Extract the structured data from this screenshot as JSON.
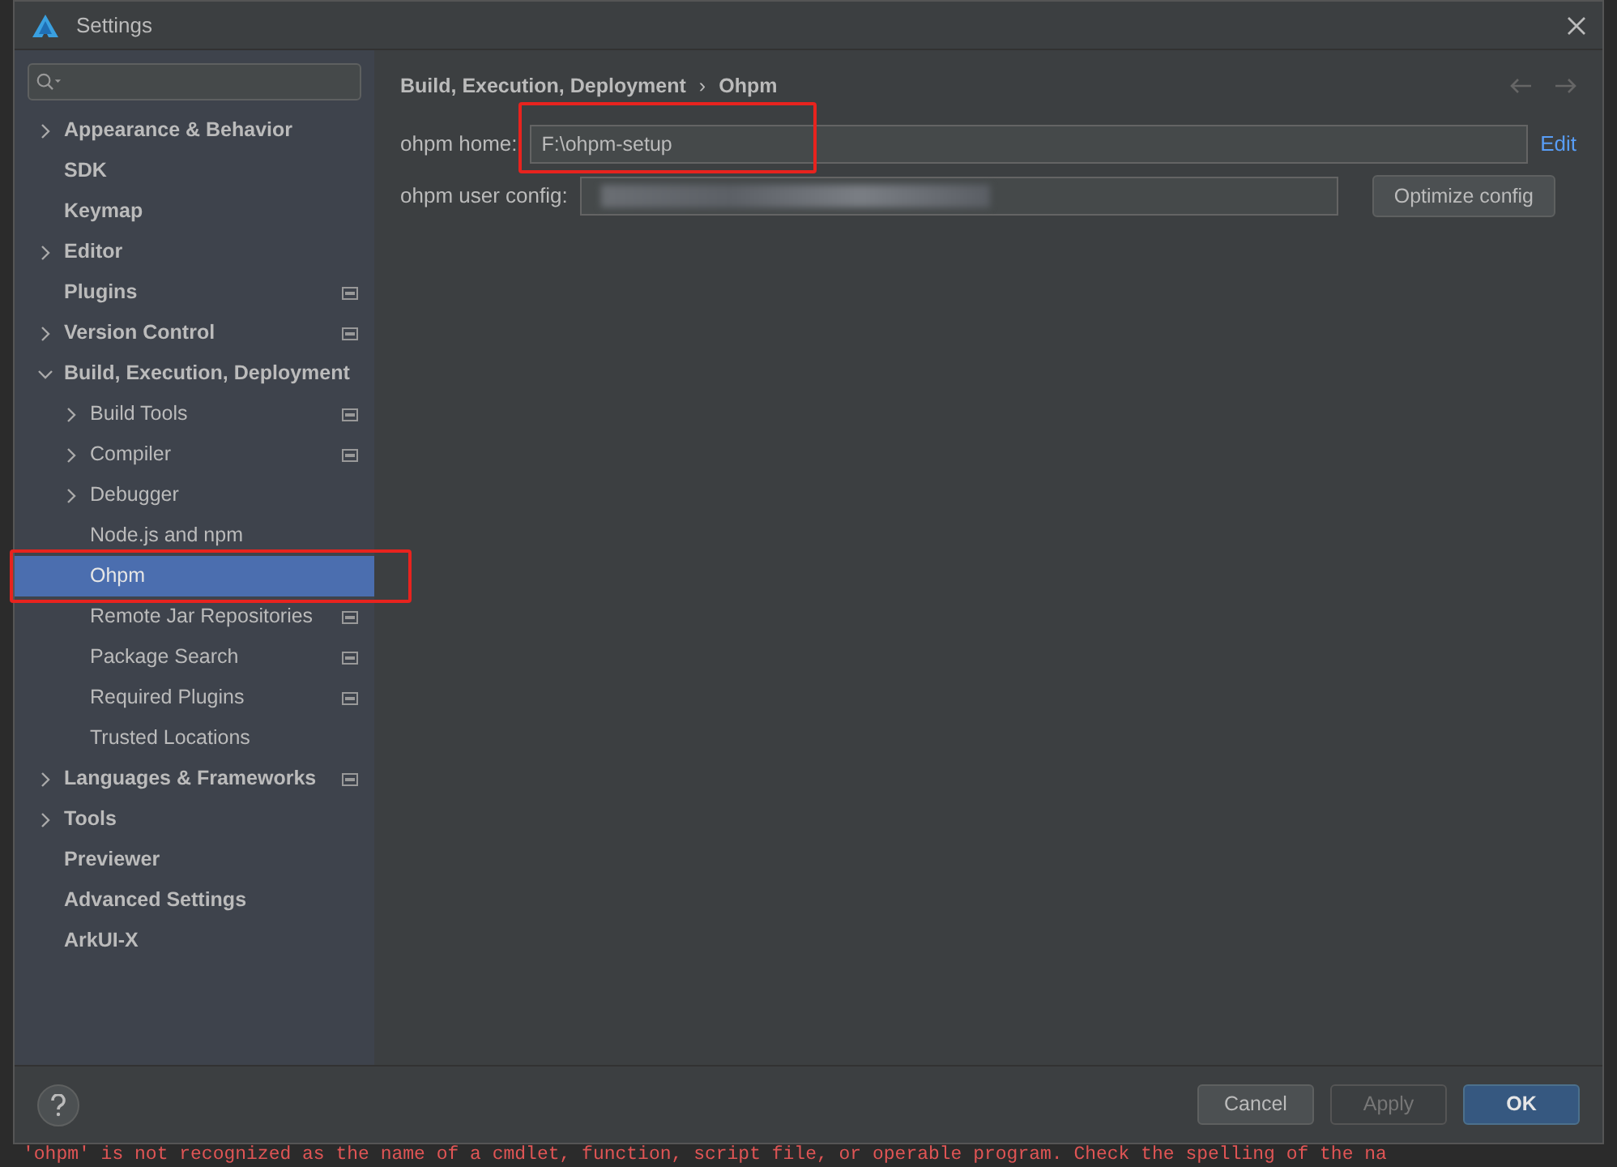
{
  "window": {
    "title": "Settings"
  },
  "sidebar": {
    "items": [
      {
        "label": "Appearance & Behavior",
        "expanded": false,
        "selected": false,
        "project_badge": false
      },
      {
        "label": "SDK",
        "selected": false,
        "project_badge": false
      },
      {
        "label": "Keymap",
        "selected": false,
        "project_badge": false
      },
      {
        "label": "Editor",
        "expanded": false,
        "selected": false,
        "project_badge": false
      },
      {
        "label": "Plugins",
        "selected": false,
        "project_badge": true
      },
      {
        "label": "Version Control",
        "expanded": false,
        "selected": false,
        "project_badge": true
      },
      {
        "label": "Build, Execution, Deployment",
        "expanded": true,
        "selected": false,
        "project_badge": false,
        "children": [
          {
            "label": "Build Tools",
            "expanded": false,
            "selected": false,
            "project_badge": true
          },
          {
            "label": "Compiler",
            "expanded": false,
            "selected": false,
            "project_badge": true
          },
          {
            "label": "Debugger",
            "expanded": false,
            "selected": false,
            "project_badge": false
          },
          {
            "label": "Node.js and npm",
            "selected": false,
            "project_badge": false
          },
          {
            "label": "Ohpm",
            "selected": true,
            "project_badge": false
          },
          {
            "label": "Remote Jar Repositories",
            "selected": false,
            "project_badge": true
          },
          {
            "label": "Package Search",
            "selected": false,
            "project_badge": true
          },
          {
            "label": "Required Plugins",
            "selected": false,
            "project_badge": true
          },
          {
            "label": "Trusted Locations",
            "selected": false,
            "project_badge": false
          }
        ]
      },
      {
        "label": "Languages & Frameworks",
        "expanded": false,
        "selected": false,
        "project_badge": true
      },
      {
        "label": "Tools",
        "expanded": false,
        "selected": false,
        "project_badge": false
      },
      {
        "label": "Previewer",
        "selected": false,
        "project_badge": false
      },
      {
        "label": "Advanced Settings",
        "selected": false,
        "project_badge": false
      },
      {
        "label": "ArkUI-X",
        "selected": false,
        "project_badge": false
      }
    ]
  },
  "breadcrumb": [
    "Build, Execution, Deployment",
    "›",
    "Ohpm"
  ],
  "form": {
    "ohpm_home": {
      "label": "ohpm home:",
      "value": "F:\\ohpm-setup",
      "link": "Edit"
    },
    "user_config": {
      "label": "ohpm user config:",
      "button": "Optimize config"
    }
  },
  "buttons": [
    {
      "label": "Cancel",
      "kind": "normal",
      "disabled": false
    },
    {
      "label": "Apply",
      "kind": "normal",
      "disabled": true
    },
    {
      "label": "OK",
      "kind": "default",
      "disabled": false
    }
  ],
  "console": {
    "line": "'ohpm' is not recognized as the name of a cmdlet, function, script file, or operable program. Check the spelling of the na"
  }
}
